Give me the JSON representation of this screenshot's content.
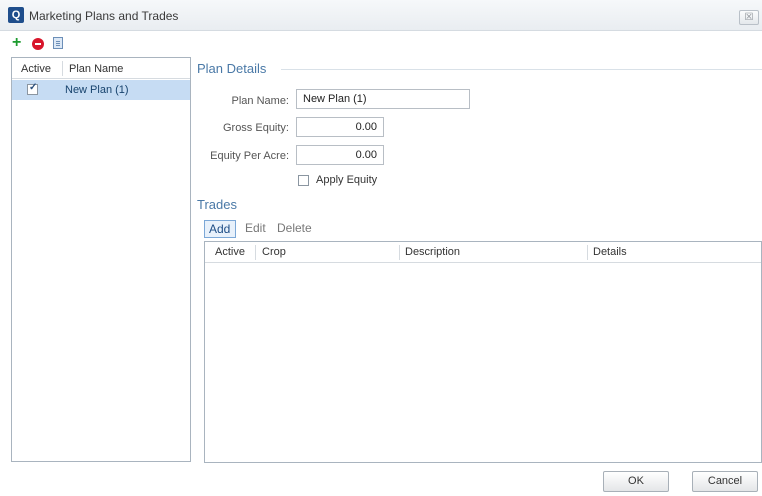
{
  "window": {
    "title": "Marketing Plans and Trades",
    "app_icon_letter": "Q",
    "close_glyph": "☒"
  },
  "toolbar": {
    "add_glyph": "+"
  },
  "plans": {
    "columns": [
      "Active",
      "Plan Name"
    ],
    "rows": [
      {
        "active": true,
        "name": "New Plan (1)"
      }
    ]
  },
  "plan_details": {
    "title": "Plan Details",
    "plan_name_label": "Plan Name:",
    "plan_name_value": "New Plan (1)",
    "gross_equity_label": "Gross Equity:",
    "gross_equity_value": "0.00",
    "equity_per_acre_label": "Equity Per Acre:",
    "equity_per_acre_value": "0.00",
    "apply_equity_label": "Apply Equity",
    "apply_equity_checked": false
  },
  "trades": {
    "title": "Trades",
    "add_label": "Add",
    "edit_label": "Edit",
    "delete_label": "Delete",
    "columns": [
      "Active",
      "Crop",
      "Description",
      "Details"
    ]
  },
  "buttons": {
    "ok": "OK",
    "cancel": "Cancel"
  }
}
